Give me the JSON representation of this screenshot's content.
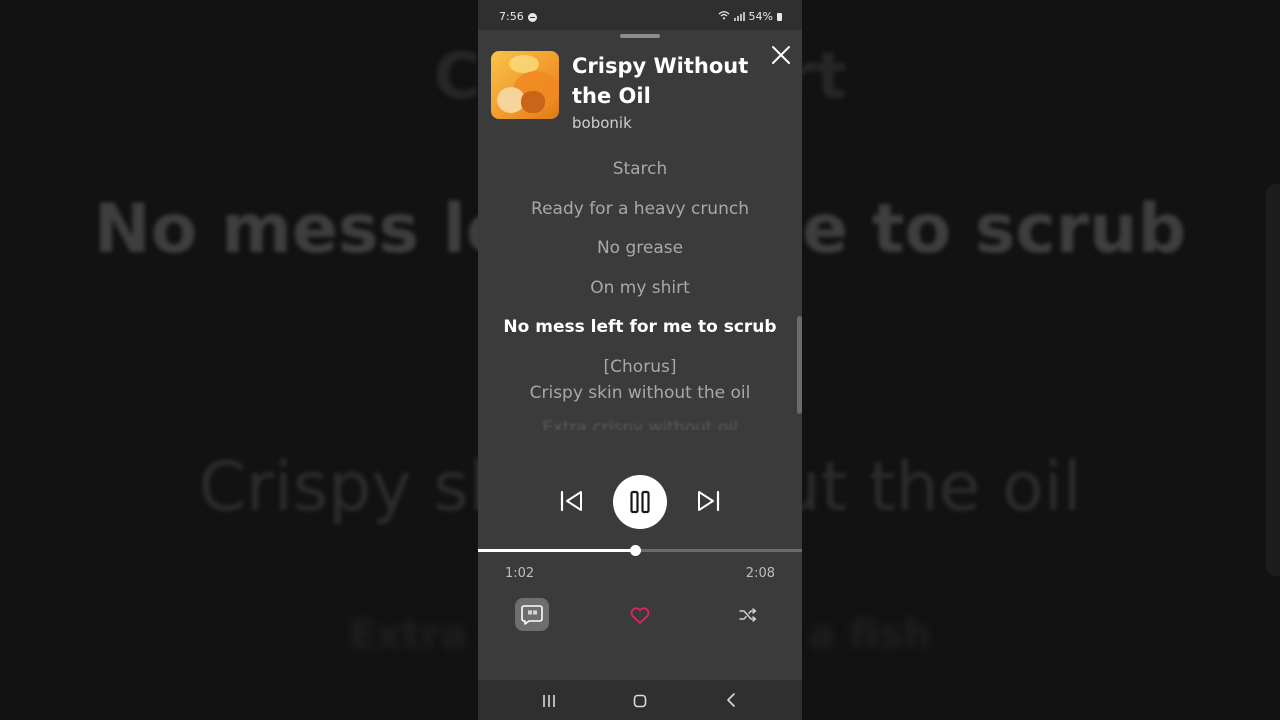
{
  "background": {
    "lines": [
      "Crispy skirt",
      "No mess left for me to scrub",
      "Crispy skin without the oil",
      "Extra oh no without a fish"
    ]
  },
  "status_bar": {
    "time": "7:56",
    "battery": "54%"
  },
  "player": {
    "title": "Crispy Without the Oil",
    "artist": "bobonik",
    "lyrics": [
      "Starch",
      "Ready for a heavy crunch",
      "No grease",
      "On my shirt",
      "No mess left for me to scrub",
      "[Chorus]",
      "Crispy skin without the oil",
      "Extra crispy without oil"
    ],
    "active_lyric_index": 4,
    "elapsed": "1:02",
    "duration": "2:08",
    "progress_fraction": 0.4839,
    "liked": true,
    "colors": {
      "accent_heart": "#e0245e",
      "background": "#3b3b3b"
    }
  }
}
